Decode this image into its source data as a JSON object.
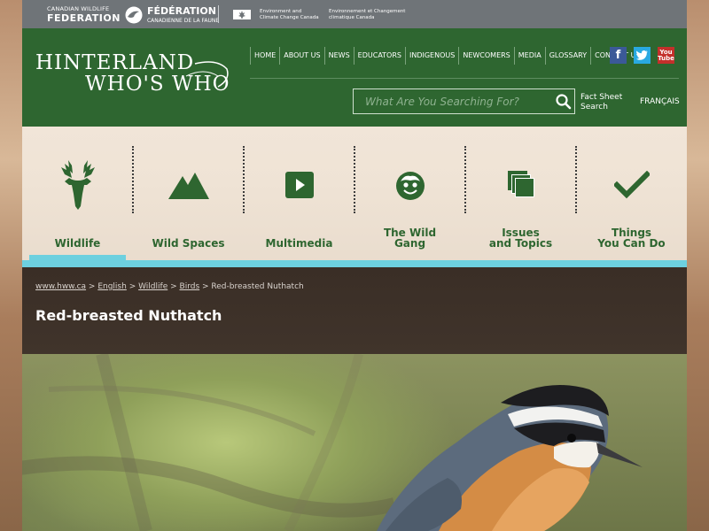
{
  "topbar": {
    "cwf_small": "CANADIAN WILDLIFE",
    "cwf_big": "FEDERATION",
    "fcf_big": "FÉDÉRATION",
    "fcf_small": "CANADIENNE DE LA FAUNE",
    "eccc_en": "Environment and Climate Change Canada",
    "eccc_fr": "Environnement et Changement climatique Canada"
  },
  "header": {
    "logo_line1": "HINTERLAND",
    "logo_line2": "WHO'S WHO",
    "nav": [
      "HOME",
      "ABOUT US",
      "NEWS",
      "EDUCATORS",
      "INDIGENOUS",
      "NEWCOMERS",
      "MEDIA",
      "GLOSSARY",
      "CONTACT US"
    ],
    "search_placeholder": "What Are You Searching For?",
    "fact_sheet_line1": "Fact Sheet",
    "fact_sheet_line2": "Search",
    "language": "FRANÇAIS",
    "youtube_you": "You",
    "youtube_tube": "Tube"
  },
  "categories": [
    {
      "line1": "Wildlife",
      "line2": "",
      "icon": "deer-icon",
      "active": true
    },
    {
      "line1": "Wild Spaces",
      "line2": "",
      "icon": "mountain-icon",
      "active": false
    },
    {
      "line1": "Multimedia",
      "line2": "",
      "icon": "play-icon",
      "active": false
    },
    {
      "line1": "The Wild",
      "line2": "Gang",
      "icon": "face-icon",
      "active": false
    },
    {
      "line1": "Issues",
      "line2": "and Topics",
      "icon": "stacked-squares-icon",
      "active": false
    },
    {
      "line1": "Things",
      "line2": "You Can Do",
      "icon": "checkmark-icon",
      "active": false
    }
  ],
  "breadcrumb": {
    "items": [
      "www.hww.ca",
      "English",
      "Wildlife",
      "Birds"
    ],
    "current": "Red-breasted Nuthatch"
  },
  "page_title": "Red-breasted Nuthatch",
  "colors": {
    "green": "#2e6630",
    "teal": "#6dd0df",
    "topbar": "#6f7478"
  }
}
